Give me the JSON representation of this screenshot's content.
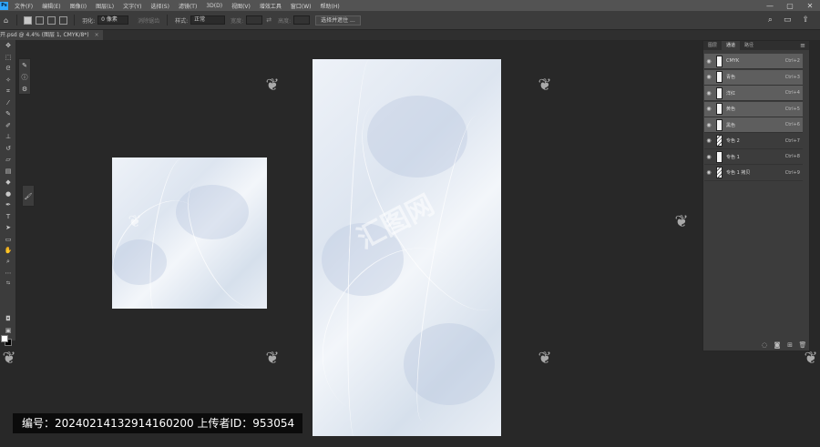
{
  "menubar": {
    "items": [
      "文件(F)",
      "编辑(E)",
      "图像(I)",
      "图层(L)",
      "文字(Y)",
      "选择(S)",
      "滤镜(T)",
      "3D(D)",
      "视图(V)",
      "增效工具",
      "窗口(W)",
      "帮助(H)"
    ],
    "window_controls": [
      "—",
      "▢",
      "✕"
    ]
  },
  "optionsbar": {
    "feather_label": "羽化:",
    "feather_value": "0 像素",
    "antialias_label": "消除锯齿",
    "style_label": "样式:",
    "style_value": "正常",
    "width_label": "宽度:",
    "height_label": "高度:",
    "select_mask_button": "选择并遮住 ..."
  },
  "document": {
    "tab_title": "开.psd @ 4.4% (图层 1, CMYK/8*)",
    "tab_close": "×"
  },
  "channels_panel": {
    "tabs": [
      "图层",
      "通道",
      "路径"
    ],
    "active_tab": "通道",
    "rows": [
      {
        "name": "CMYK",
        "shortcut": "Ctrl+2",
        "selected": true,
        "spot": false
      },
      {
        "name": "青色",
        "shortcut": "Ctrl+3",
        "selected": true,
        "spot": false
      },
      {
        "name": "洋红",
        "shortcut": "Ctrl+4",
        "selected": true,
        "spot": false
      },
      {
        "name": "黄色",
        "shortcut": "Ctrl+5",
        "selected": true,
        "spot": false
      },
      {
        "name": "黑色",
        "shortcut": "Ctrl+6",
        "selected": true,
        "spot": false
      },
      {
        "name": "专色 2",
        "shortcut": "Ctrl+7",
        "selected": false,
        "spot": true
      },
      {
        "name": "专色 1",
        "shortcut": "Ctrl+8",
        "selected": false,
        "spot": false
      },
      {
        "name": "专色 1 拷贝",
        "shortcut": "Ctrl+9",
        "selected": false,
        "spot": true
      }
    ]
  },
  "watermark": {
    "id_text": "编号：20240214132914160200   上传者ID：953054",
    "brand_text": "汇图网"
  },
  "colors": {
    "accent": "#31a8ff",
    "panel_bg": "#3c3c3c",
    "canvas_bg": "#282828",
    "selected_row": "#5e5e5e"
  }
}
